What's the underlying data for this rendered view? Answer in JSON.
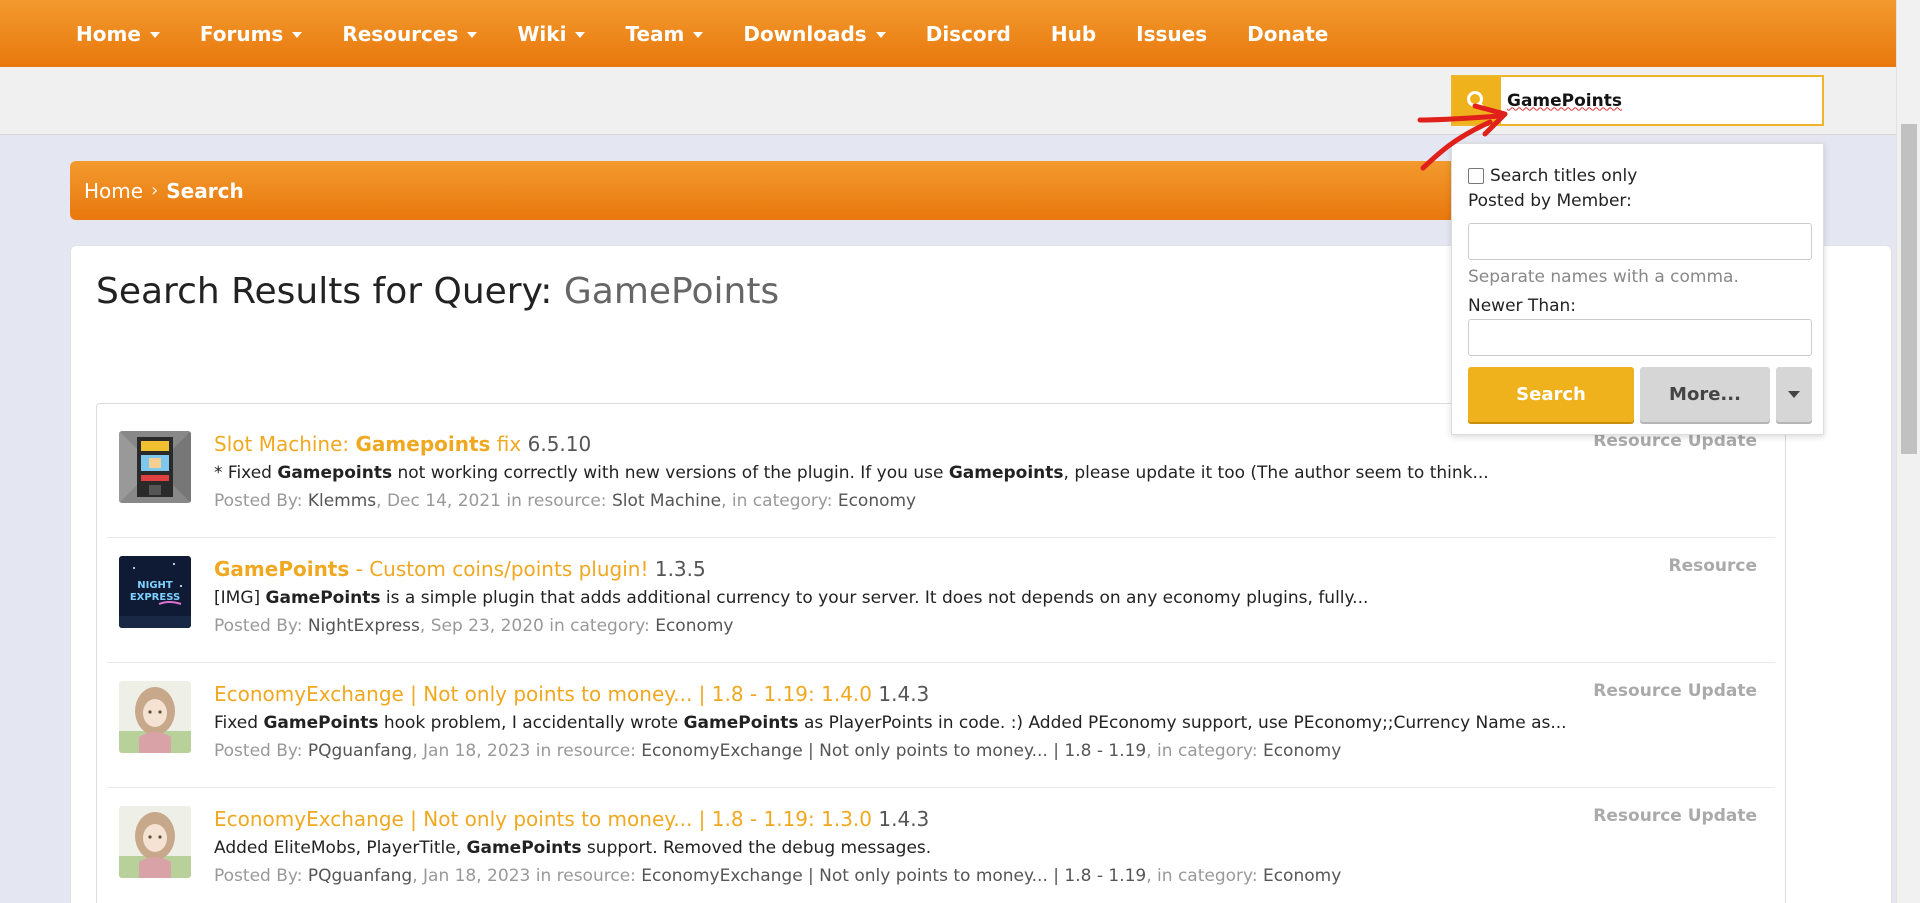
{
  "nav": {
    "items": [
      {
        "label": "Home",
        "dropdown": true
      },
      {
        "label": "Forums",
        "dropdown": true
      },
      {
        "label": "Resources",
        "dropdown": true
      },
      {
        "label": "Wiki",
        "dropdown": true
      },
      {
        "label": "Team",
        "dropdown": true
      },
      {
        "label": "Downloads",
        "dropdown": true
      },
      {
        "label": "Discord",
        "dropdown": false
      },
      {
        "label": "Hub",
        "dropdown": false
      },
      {
        "label": "Issues",
        "dropdown": false
      },
      {
        "label": "Donate",
        "dropdown": false
      }
    ]
  },
  "search": {
    "value": "GamePoints",
    "icon": "search-icon"
  },
  "breadcrumb": {
    "home": "Home",
    "current": "Search"
  },
  "page": {
    "title_prefix": "Search Results for Query:",
    "query": "GamePoints"
  },
  "search_dropdown": {
    "titles_only_label": "Search titles only",
    "titles_only_checked": false,
    "posted_by_label": "Posted by Member:",
    "posted_by_value": "",
    "hint": "Separate names with a comma.",
    "newer_than_label": "Newer Than:",
    "newer_than_value": "",
    "search_button": "Search",
    "more_button": "More..."
  },
  "results": [
    {
      "title_pre": "Slot Machine: ",
      "title_bold": "Gamepoints",
      "title_post": " fix",
      "version": "6.5.10",
      "snippet_parts": [
        {
          "t": "* Fixed ",
          "b": false
        },
        {
          "t": "Gamepoints",
          "b": true
        },
        {
          "t": " not working correctly with new versions of the plugin. If you use ",
          "b": false
        },
        {
          "t": "Gamepoints",
          "b": true
        },
        {
          "t": ", please update it too (The author seem to think...",
          "b": false
        }
      ],
      "meta_parts": [
        {
          "t": "Posted By: ",
          "h": false
        },
        {
          "t": "Klemms",
          "h": true
        },
        {
          "t": ", Dec 14, 2021 in resource: ",
          "h": false
        },
        {
          "t": "Slot Machine",
          "h": true
        },
        {
          "t": ", in category: ",
          "h": false
        },
        {
          "t": "Economy",
          "h": true
        }
      ],
      "type": "Resource Update",
      "avatar": "slot-machine"
    },
    {
      "title_pre": "",
      "title_bold": "GamePoints",
      "title_post": " - Custom coins/points plugin!",
      "version": "1.3.5",
      "snippet_parts": [
        {
          "t": "[IMG] ",
          "b": false
        },
        {
          "t": "GamePoints",
          "b": true
        },
        {
          "t": " is a simple plugin that adds additional currency to your server. It does not depends on any economy plugins, fully...",
          "b": false
        }
      ],
      "meta_parts": [
        {
          "t": "Posted By: ",
          "h": false
        },
        {
          "t": "NightExpress",
          "h": true
        },
        {
          "t": ", Sep 23, 2020 in category: ",
          "h": false
        },
        {
          "t": "Economy",
          "h": true
        }
      ],
      "type": "Resource",
      "avatar": "night-express",
      "avatar_text_1": "NIGHT",
      "avatar_text_2": "EXPRESS"
    },
    {
      "title_pre": "EconomyExchange | Not only points to money... | 1.8 - 1.19: 1.4.0",
      "title_bold": "",
      "title_post": "",
      "version": "1.4.3",
      "snippet_parts": [
        {
          "t": "Fixed ",
          "b": false
        },
        {
          "t": "GamePoints",
          "b": true
        },
        {
          "t": " hook problem, I accidentally wrote ",
          "b": false
        },
        {
          "t": "GamePoints",
          "b": true
        },
        {
          "t": " as PlayerPoints in code. :) Added PEconomy support, use PEconomy;;Currency Name as...",
          "b": false
        }
      ],
      "meta_parts": [
        {
          "t": "Posted By: ",
          "h": false
        },
        {
          "t": "PQguanfang",
          "h": true
        },
        {
          "t": ", Jan 18, 2023 in resource: ",
          "h": false
        },
        {
          "t": "EconomyExchange | Not only points to money... | 1.8 - 1.19",
          "h": true
        },
        {
          "t": ", in category: ",
          "h": false
        },
        {
          "t": "Economy",
          "h": true
        }
      ],
      "type": "Resource Update",
      "avatar": "anime-girl"
    },
    {
      "title_pre": "EconomyExchange | Not only points to money... | 1.8 - 1.19: 1.3.0",
      "title_bold": "",
      "title_post": "",
      "version": "1.4.3",
      "snippet_parts": [
        {
          "t": "Added EliteMobs, PlayerTitle, ",
          "b": false
        },
        {
          "t": "GamePoints",
          "b": true
        },
        {
          "t": " support. Removed the debug messages.",
          "b": false
        }
      ],
      "meta_parts": [
        {
          "t": "Posted By: ",
          "h": false
        },
        {
          "t": "PQguanfang",
          "h": true
        },
        {
          "t": ", Jan 18, 2023 in resource: ",
          "h": false
        },
        {
          "t": "EconomyExchange | Not only points to money... | 1.8 - 1.19",
          "h": true
        },
        {
          "t": ", in category: ",
          "h": false
        },
        {
          "t": "Economy",
          "h": true
        }
      ],
      "type": "Resource Update",
      "avatar": "anime-girl"
    }
  ],
  "colors": {
    "brand_orange": "#ee8a1e",
    "accent_yellow": "#f0b21c",
    "link": "#f0a820",
    "annotation_red": "#e0201a"
  }
}
